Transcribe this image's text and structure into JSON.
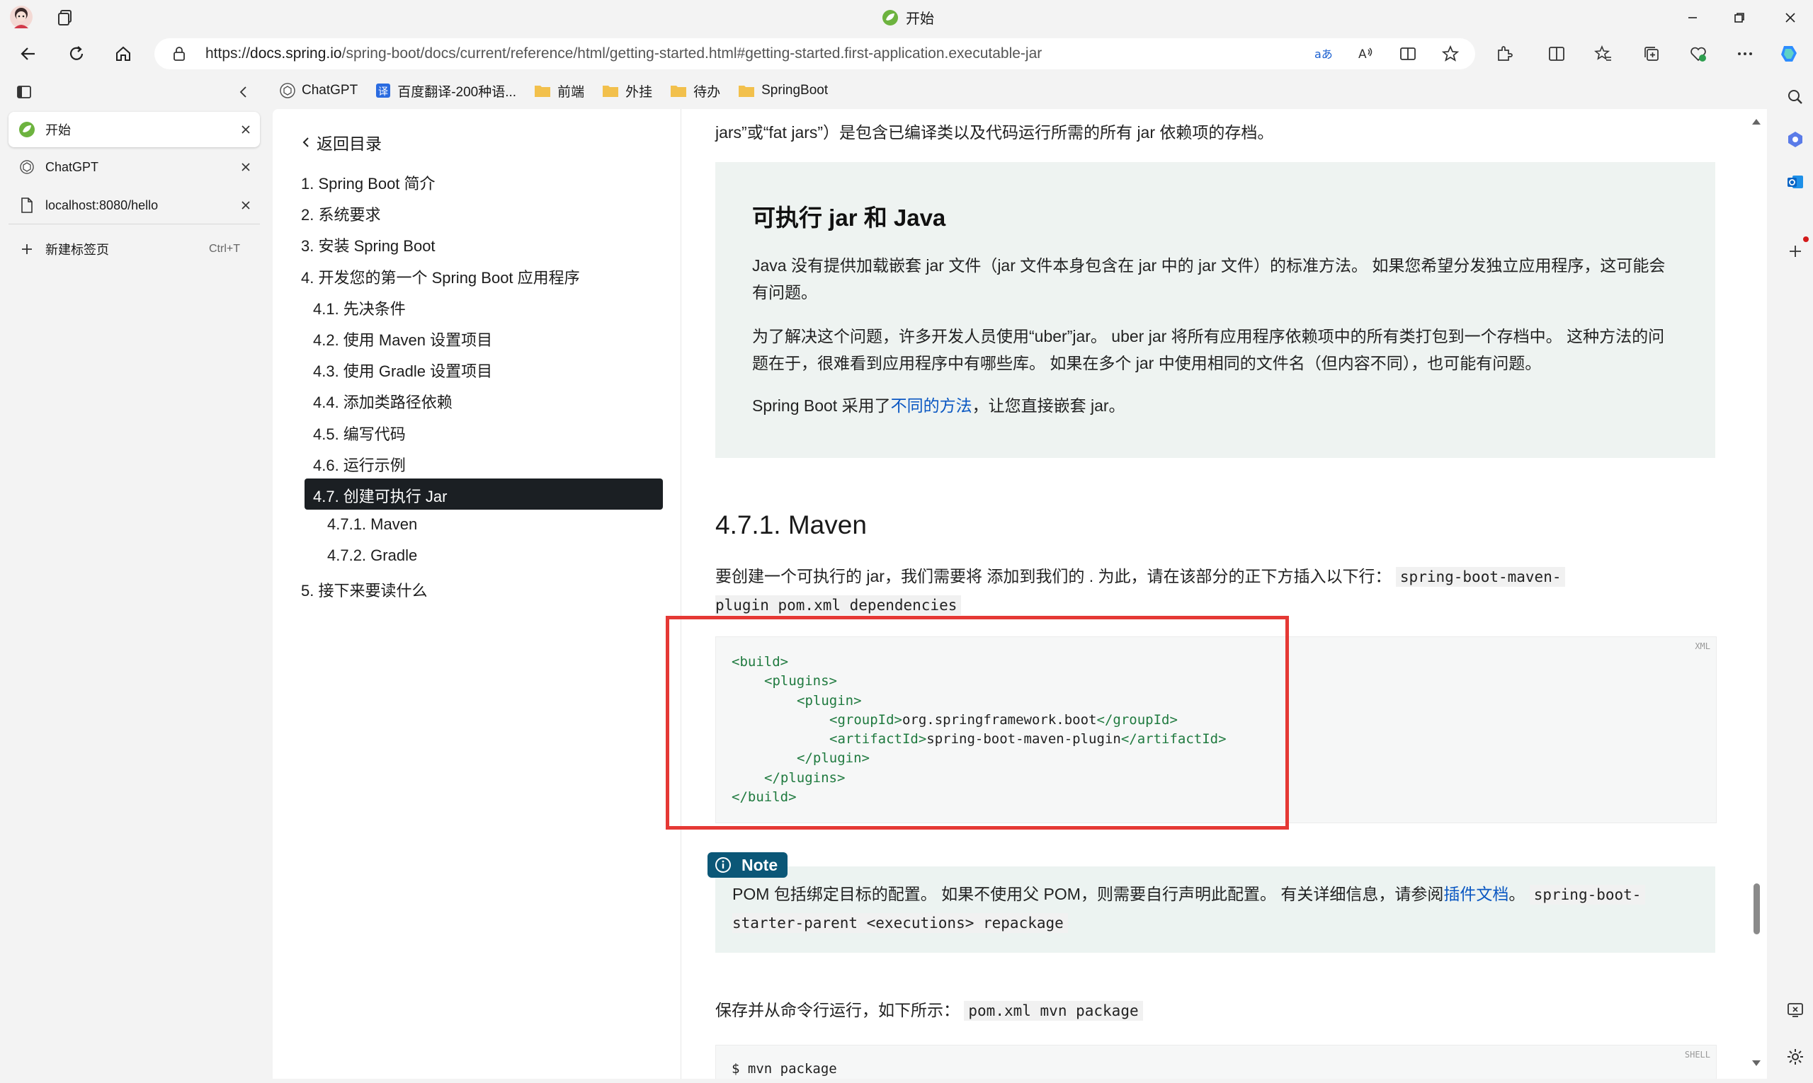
{
  "window": {
    "title": "开始"
  },
  "address": {
    "scheme": "https://",
    "host": "docs.spring.io",
    "path": "/spring-boot/docs/current/reference/html/getting-started.html#getting-started.first-application.executable-jar"
  },
  "bookmarks": [
    {
      "label": "ChatGPT",
      "icon": "chatgpt-icon"
    },
    {
      "label": "百度翻译-200种语...",
      "icon": "translate-icon"
    },
    {
      "label": "前端",
      "icon": "folder-icon"
    },
    {
      "label": "外挂",
      "icon": "folder-icon"
    },
    {
      "label": "待办",
      "icon": "folder-icon"
    },
    {
      "label": "SpringBoot",
      "icon": "folder-icon"
    }
  ],
  "tabs": [
    {
      "label": "开始",
      "icon": "spring-icon",
      "active": true
    },
    {
      "label": "ChatGPT",
      "icon": "chatgpt-icon",
      "active": false
    },
    {
      "label": "localhost:8080/hello",
      "icon": "page-icon",
      "active": false
    }
  ],
  "new_tab": {
    "label": "新建标签页",
    "shortcut": "Ctrl+T"
  },
  "toc": {
    "back": "返回目录",
    "items": [
      {
        "label": "1. Spring Boot 简介",
        "level": 0
      },
      {
        "label": "2. 系统要求",
        "level": 0
      },
      {
        "label": "3. 安装 Spring Boot",
        "level": 0
      },
      {
        "label": "4. 开发您的第一个 Spring Boot 应用程序",
        "level": 0
      },
      {
        "label": "4.1. 先决条件",
        "level": 1
      },
      {
        "label": "4.2. 使用 Maven 设置项目",
        "level": 1
      },
      {
        "label": "4.3. 使用 Gradle 设置项目",
        "level": 1
      },
      {
        "label": "4.4. 添加类路径依赖",
        "level": 1
      },
      {
        "label": "4.5. 编写代码",
        "level": 1
      },
      {
        "label": "4.6. 运行示例",
        "level": 1
      },
      {
        "label": "4.7. 创建可执行 Jar",
        "level": 1,
        "active": true
      },
      {
        "label": "4.7.1. Maven",
        "level": 2
      },
      {
        "label": "4.7.2. Gradle",
        "level": 2
      },
      {
        "label": "5. 接下来要读什么",
        "level": 0
      }
    ]
  },
  "content": {
    "top_partial": "jars”或“fat jars”）是包含已编译类以及代码运行所需的所有 jar 依赖项的存档。",
    "sidebar": {
      "title": "可执行 jar 和 Java",
      "p1": "Java 没有提供加载嵌套 jar 文件（jar 文件本身包含在 jar 中的 jar 文件）的标准方法。 如果您希望分发独立应用程序，这可能会有问题。",
      "p2": "为了解决这个问题，许多开发人员使用“uber”jar。 uber jar 将所有应用程序依赖项中的所有类打包到一个存档中。 这种方法的问题在于，很难看到应用程序中有哪些库。 如果在多个 jar 中使用相同的文件名（但内容不同），也可能有问题。",
      "p3_before": "Spring Boot 采用了",
      "p3_link": "不同的方法",
      "p3_after": "，让您直接嵌套 jar。"
    },
    "maven_heading": "4.7.1. Maven",
    "maven_text": "要创建一个可执行的 jar，我们需要将 添加到我们的 . 为此，请在该部分的正下方插入以下行：",
    "maven_code1": "spring-boot-maven-",
    "maven_code2": "plugin pom.xml dependencies",
    "code_lang": "XML",
    "code_lines": [
      {
        "indent": 0,
        "open": "<build>",
        "text": "",
        "close": ""
      },
      {
        "indent": 1,
        "open": "<plugins>",
        "text": "",
        "close": ""
      },
      {
        "indent": 2,
        "open": "<plugin>",
        "text": "",
        "close": ""
      },
      {
        "indent": 3,
        "open": "<groupId>",
        "text": "org.springframework.boot",
        "close": "</groupId>"
      },
      {
        "indent": 3,
        "open": "<artifactId>",
        "text": "spring-boot-maven-plugin",
        "close": "</artifactId>"
      },
      {
        "indent": 2,
        "open": "</plugin>",
        "text": "",
        "close": ""
      },
      {
        "indent": 1,
        "open": "</plugins>",
        "text": "",
        "close": ""
      },
      {
        "indent": 0,
        "open": "</build>",
        "text": "",
        "close": ""
      }
    ],
    "note": {
      "badge": "Note",
      "text_before": "POM 包括绑定目标的配置。 如果不使用父 POM，则需要自行声明此配置。 有关详细信息，请参阅",
      "link": "插件文档",
      "text_after": "。",
      "code1": "spring-boot-",
      "code2": "starter-parent <executions> repackage"
    },
    "save_text": "保存并从命令行运行，如下所示：",
    "save_code": "pom.xml mvn package",
    "shell_lang": "SHELL",
    "shell_line": "$ mvn package"
  },
  "colors": {
    "highlight": "#e53935",
    "link": "#0a57c2",
    "toc_active_bg": "#1b1f23",
    "note_badge": "#0b5777",
    "xml_tag": "#1f7a3f"
  }
}
